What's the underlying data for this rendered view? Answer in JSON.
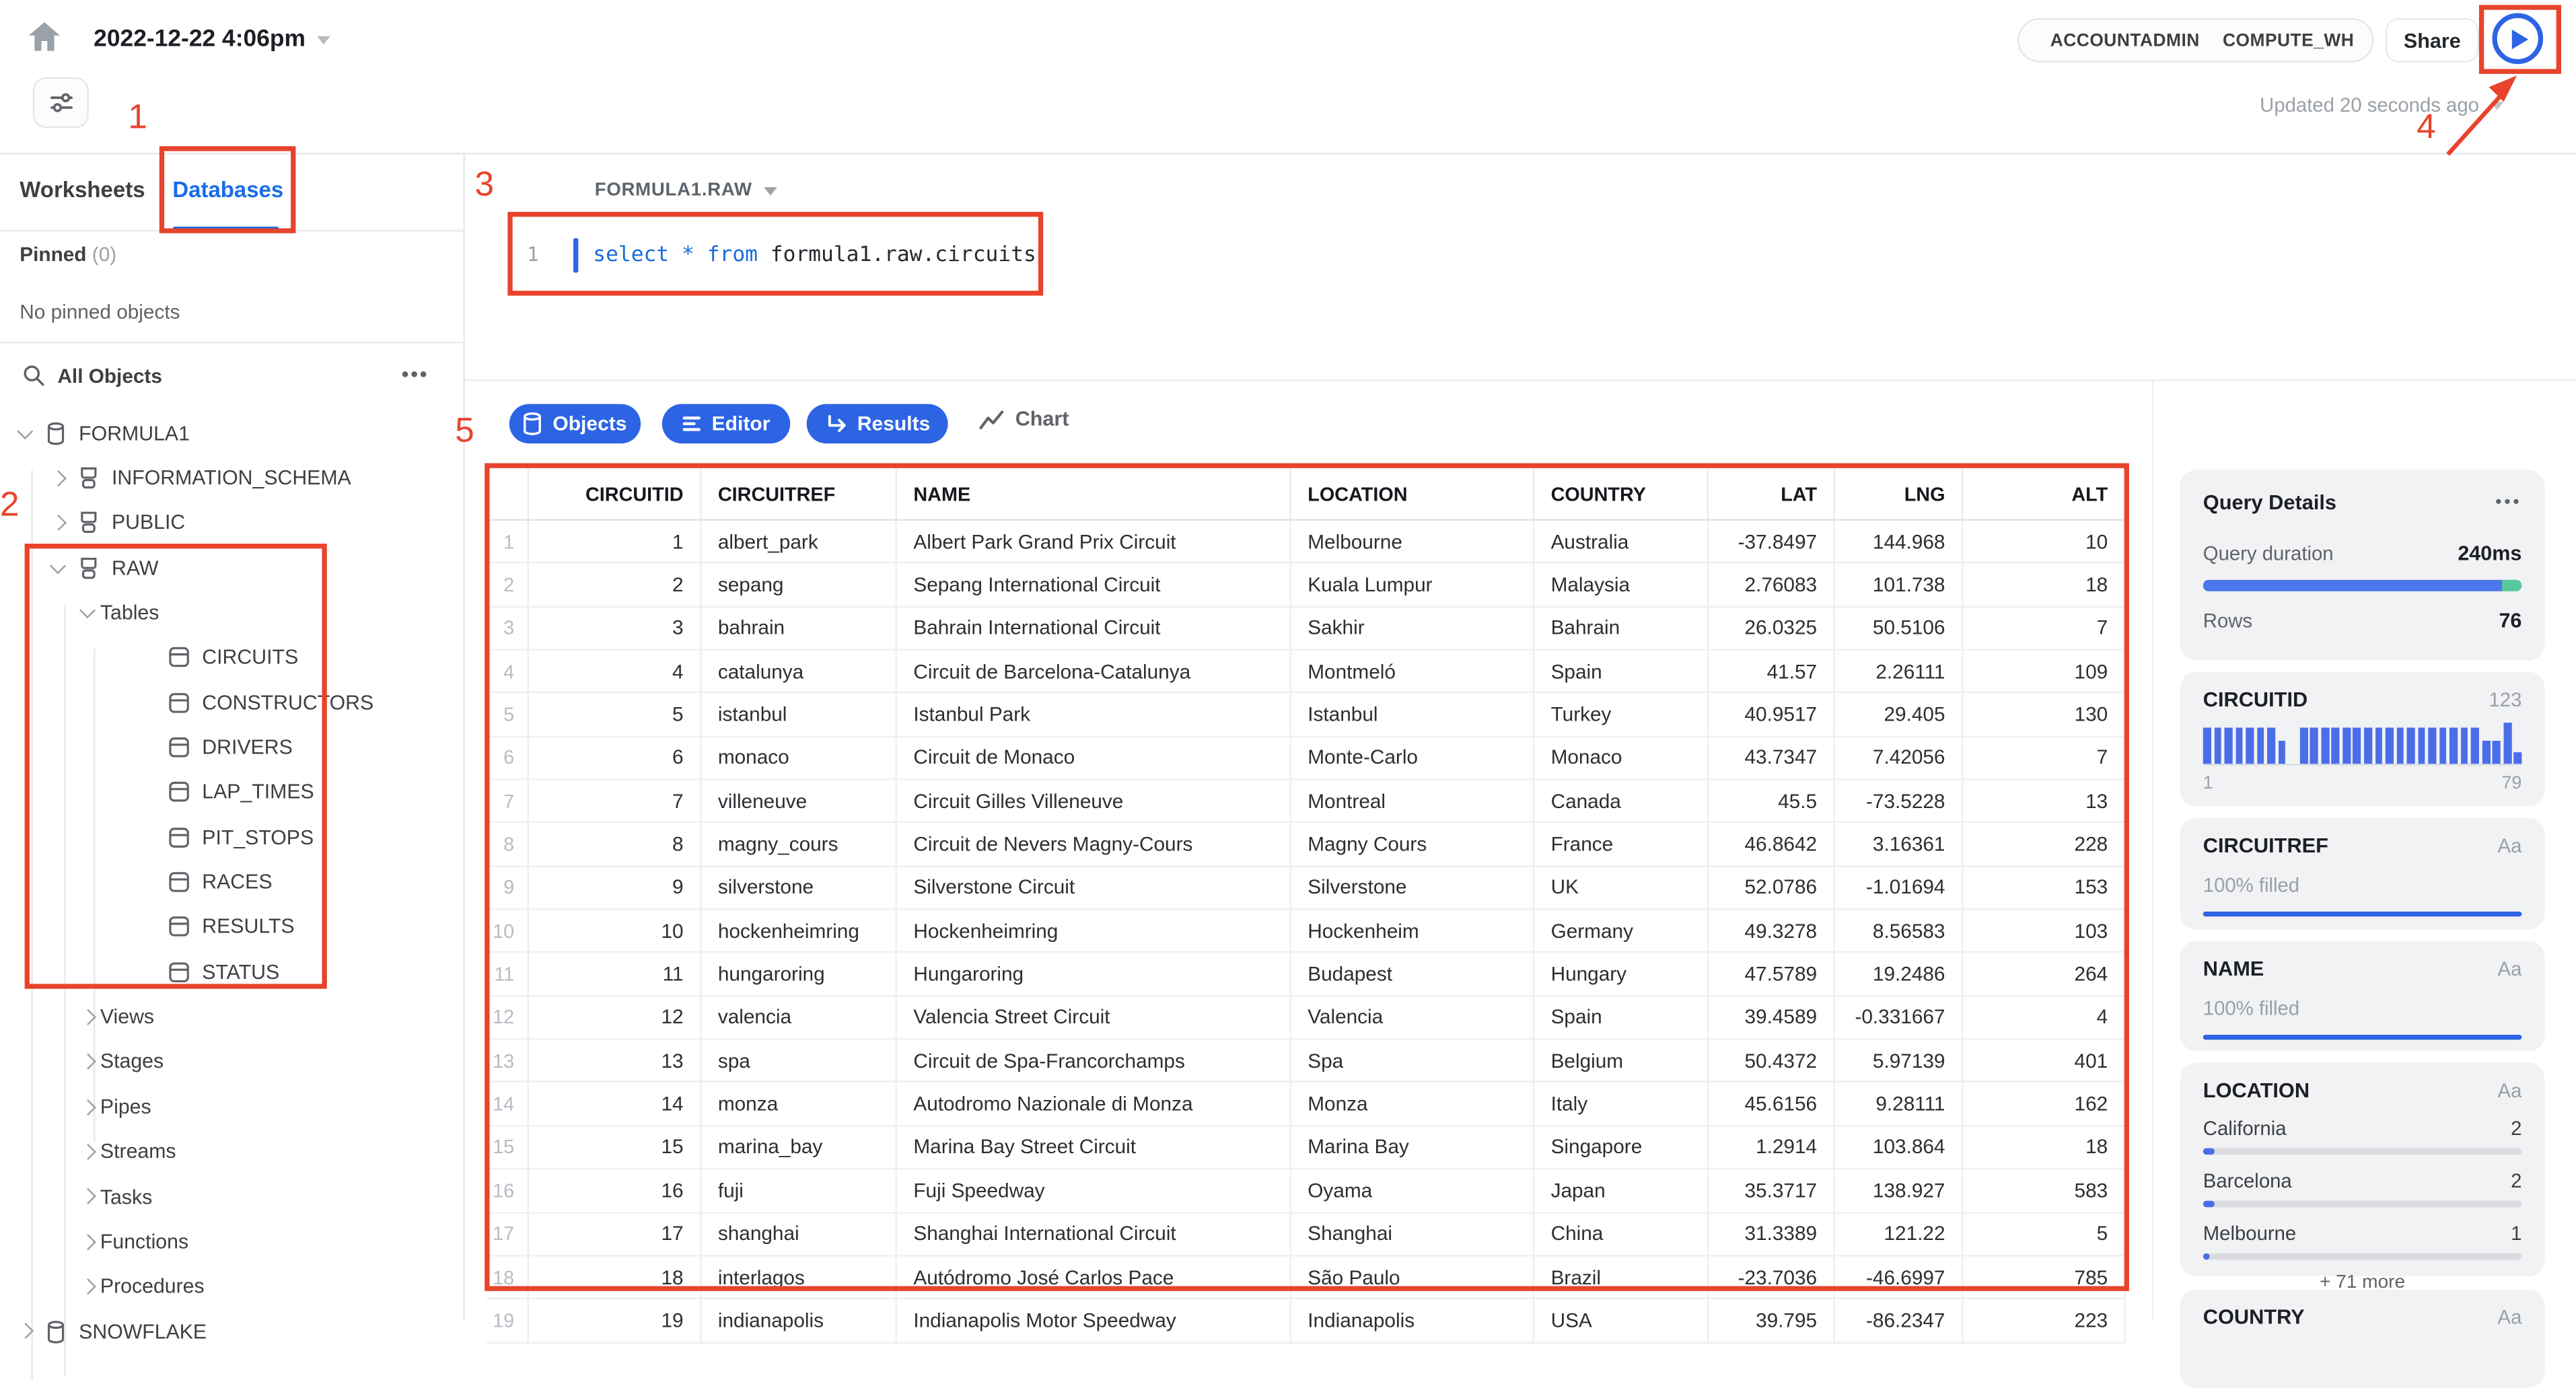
{
  "header": {
    "title": "2022-12-22 4:06pm",
    "role": "ACCOUNTADMIN",
    "warehouse": "COMPUTE_WH",
    "share_label": "Share",
    "updated_label": "Updated 20 seconds ago"
  },
  "sidebar": {
    "tabs": {
      "worksheets": "Worksheets",
      "databases": "Databases"
    },
    "pinned_label": "Pinned",
    "pinned_count": "(0)",
    "pinned_empty": "No pinned objects",
    "search_label": "All Objects",
    "menu_icon": "•••",
    "tree": [
      {
        "label": "FORMULA1",
        "depth": 0,
        "icon": "db",
        "chevron": "down"
      },
      {
        "label": "INFORMATION_SCHEMA",
        "depth": 1,
        "icon": "schema",
        "chevron": "right"
      },
      {
        "label": "PUBLIC",
        "depth": 1,
        "icon": "schema",
        "chevron": "right"
      },
      {
        "label": "RAW",
        "depth": 1,
        "icon": "schema",
        "chevron": "down"
      },
      {
        "label": "Tables",
        "depth": 2,
        "icon": "none",
        "chevron": "down"
      },
      {
        "label": "CIRCUITS",
        "depth": 3,
        "icon": "table",
        "chevron": "none"
      },
      {
        "label": "CONSTRUCTORS",
        "depth": 3,
        "icon": "table",
        "chevron": "none"
      },
      {
        "label": "DRIVERS",
        "depth": 3,
        "icon": "table",
        "chevron": "none"
      },
      {
        "label": "LAP_TIMES",
        "depth": 3,
        "icon": "table",
        "chevron": "none"
      },
      {
        "label": "PIT_STOPS",
        "depth": 3,
        "icon": "table",
        "chevron": "none"
      },
      {
        "label": "RACES",
        "depth": 3,
        "icon": "table",
        "chevron": "none"
      },
      {
        "label": "RESULTS",
        "depth": 3,
        "icon": "table",
        "chevron": "none"
      },
      {
        "label": "STATUS",
        "depth": 3,
        "icon": "table",
        "chevron": "none"
      },
      {
        "label": "Views",
        "depth": 2,
        "icon": "none",
        "chevron": "right"
      },
      {
        "label": "Stages",
        "depth": 2,
        "icon": "none",
        "chevron": "right"
      },
      {
        "label": "Pipes",
        "depth": 2,
        "icon": "none",
        "chevron": "right"
      },
      {
        "label": "Streams",
        "depth": 2,
        "icon": "none",
        "chevron": "right"
      },
      {
        "label": "Tasks",
        "depth": 2,
        "icon": "none",
        "chevron": "right"
      },
      {
        "label": "Functions",
        "depth": 2,
        "icon": "none",
        "chevron": "right"
      },
      {
        "label": "Procedures",
        "depth": 2,
        "icon": "none",
        "chevron": "right"
      },
      {
        "label": "SNOWFLAKE",
        "depth": 0,
        "icon": "db",
        "chevron": "right"
      }
    ]
  },
  "editor": {
    "context": "FORMULA1.RAW",
    "line_number": "1",
    "sql_tokens": [
      {
        "text": "select",
        "type": "keyword"
      },
      {
        "text": " ",
        "type": "plain"
      },
      {
        "text": "*",
        "type": "keyword"
      },
      {
        "text": " ",
        "type": "plain"
      },
      {
        "text": "from",
        "type": "keyword"
      },
      {
        "text": " formula1.raw.circuits",
        "type": "plain"
      }
    ]
  },
  "results_toolbar": {
    "objects": "Objects",
    "editor": "Editor",
    "results": "Results",
    "chart": "Chart"
  },
  "results_table": {
    "columns": [
      {
        "label": "CIRCUITID",
        "align": "right"
      },
      {
        "label": "CIRCUITREF",
        "align": "left"
      },
      {
        "label": "NAME",
        "align": "left"
      },
      {
        "label": "LOCATION",
        "align": "left"
      },
      {
        "label": "COUNTRY",
        "align": "left"
      },
      {
        "label": "LAT",
        "align": "right"
      },
      {
        "label": "LNG",
        "align": "right"
      },
      {
        "label": "ALT",
        "align": "right"
      }
    ],
    "rows": [
      [
        "1",
        "albert_park",
        "Albert Park Grand Prix Circuit",
        "Melbourne",
        "Australia",
        "-37.8497",
        "144.968",
        "10"
      ],
      [
        "2",
        "sepang",
        "Sepang International Circuit",
        "Kuala Lumpur",
        "Malaysia",
        "2.76083",
        "101.738",
        "18"
      ],
      [
        "3",
        "bahrain",
        "Bahrain International Circuit",
        "Sakhir",
        "Bahrain",
        "26.0325",
        "50.5106",
        "7"
      ],
      [
        "4",
        "catalunya",
        "Circuit de Barcelona-Catalunya",
        "Montmeló",
        "Spain",
        "41.57",
        "2.26111",
        "109"
      ],
      [
        "5",
        "istanbul",
        "Istanbul Park",
        "Istanbul",
        "Turkey",
        "40.9517",
        "29.405",
        "130"
      ],
      [
        "6",
        "monaco",
        "Circuit de Monaco",
        "Monte-Carlo",
        "Monaco",
        "43.7347",
        "7.42056",
        "7"
      ],
      [
        "7",
        "villeneuve",
        "Circuit Gilles Villeneuve",
        "Montreal",
        "Canada",
        "45.5",
        "-73.5228",
        "13"
      ],
      [
        "8",
        "magny_cours",
        "Circuit de Nevers Magny-Cours",
        "Magny Cours",
        "France",
        "46.8642",
        "3.16361",
        "228"
      ],
      [
        "9",
        "silverstone",
        "Silverstone Circuit",
        "Silverstone",
        "UK",
        "52.0786",
        "-1.01694",
        "153"
      ],
      [
        "10",
        "hockenheimring",
        "Hockenheimring",
        "Hockenheim",
        "Germany",
        "49.3278",
        "8.56583",
        "103"
      ],
      [
        "11",
        "hungaroring",
        "Hungaroring",
        "Budapest",
        "Hungary",
        "47.5789",
        "19.2486",
        "264"
      ],
      [
        "12",
        "valencia",
        "Valencia Street Circuit",
        "Valencia",
        "Spain",
        "39.4589",
        "-0.331667",
        "4"
      ],
      [
        "13",
        "spa",
        "Circuit de Spa-Francorchamps",
        "Spa",
        "Belgium",
        "50.4372",
        "5.97139",
        "401"
      ],
      [
        "14",
        "monza",
        "Autodromo Nazionale di Monza",
        "Monza",
        "Italy",
        "45.6156",
        "9.28111",
        "162"
      ],
      [
        "15",
        "marina_bay",
        "Marina Bay Street Circuit",
        "Marina Bay",
        "Singapore",
        "1.2914",
        "103.864",
        "18"
      ],
      [
        "16",
        "fuji",
        "Fuji Speedway",
        "Oyama",
        "Japan",
        "35.3717",
        "138.927",
        "583"
      ],
      [
        "17",
        "shanghai",
        "Shanghai International Circuit",
        "Shanghai",
        "China",
        "31.3389",
        "121.22",
        "5"
      ],
      [
        "18",
        "interlagos",
        "Autódromo José Carlos Pace",
        "São Paulo",
        "Brazil",
        "-23.7036",
        "-46.6997",
        "785"
      ],
      [
        "19",
        "indianapolis",
        "Indianapolis Motor Speedway",
        "Indianapolis",
        "USA",
        "39.795",
        "-86.2347",
        "223"
      ]
    ]
  },
  "query_panel": {
    "query_details": {
      "title": "Query Details",
      "menu_icon": "•••",
      "duration_label": "Query duration",
      "duration_value": "240ms",
      "rows_label": "Rows",
      "rows_value": "76",
      "progress_blue_fraction": 0.94,
      "progress_green_fraction": 0.06
    },
    "circuitid": {
      "label": "CIRCUITID",
      "type": "123",
      "range_min": "1",
      "range_max": "79",
      "histogram": [
        0.88,
        0.88,
        0.88,
        0.88,
        0.88,
        0.88,
        0.88,
        0.58,
        0,
        0.88,
        0.88,
        0.88,
        0.88,
        0.88,
        0.88,
        0.88,
        0.88,
        0.88,
        0.88,
        0.88,
        0.88,
        0.88,
        0.88,
        0.88,
        0.88,
        0.88,
        0.58,
        0.58,
        1.0,
        0.27
      ]
    },
    "circuitref": {
      "label": "CIRCUITREF",
      "type": "Aa",
      "filled": "100% filled"
    },
    "name": {
      "label": "NAME",
      "type": "Aa",
      "filled": "100% filled"
    },
    "location": {
      "label": "LOCATION",
      "type": "Aa",
      "entries": [
        {
          "label": "California",
          "count": "2",
          "fraction": 0.035
        },
        {
          "label": "Barcelona",
          "count": "2",
          "fraction": 0.035
        },
        {
          "label": "Melbourne",
          "count": "1",
          "fraction": 0.02
        }
      ],
      "more_label": "+ 71 more"
    },
    "country": {
      "label": "COUNTRY",
      "type": "Aa"
    }
  },
  "annotations": {
    "n1": "1",
    "n2": "2",
    "n3": "3",
    "n4": "4",
    "n5": "5"
  },
  "colors": {
    "accent_blue": "#2c64e4",
    "keyword_blue": "#1a6bdd",
    "annotation_red": "#e8432c",
    "progress_green": "#57c89b",
    "histogram_blue": "#4a6de8"
  }
}
